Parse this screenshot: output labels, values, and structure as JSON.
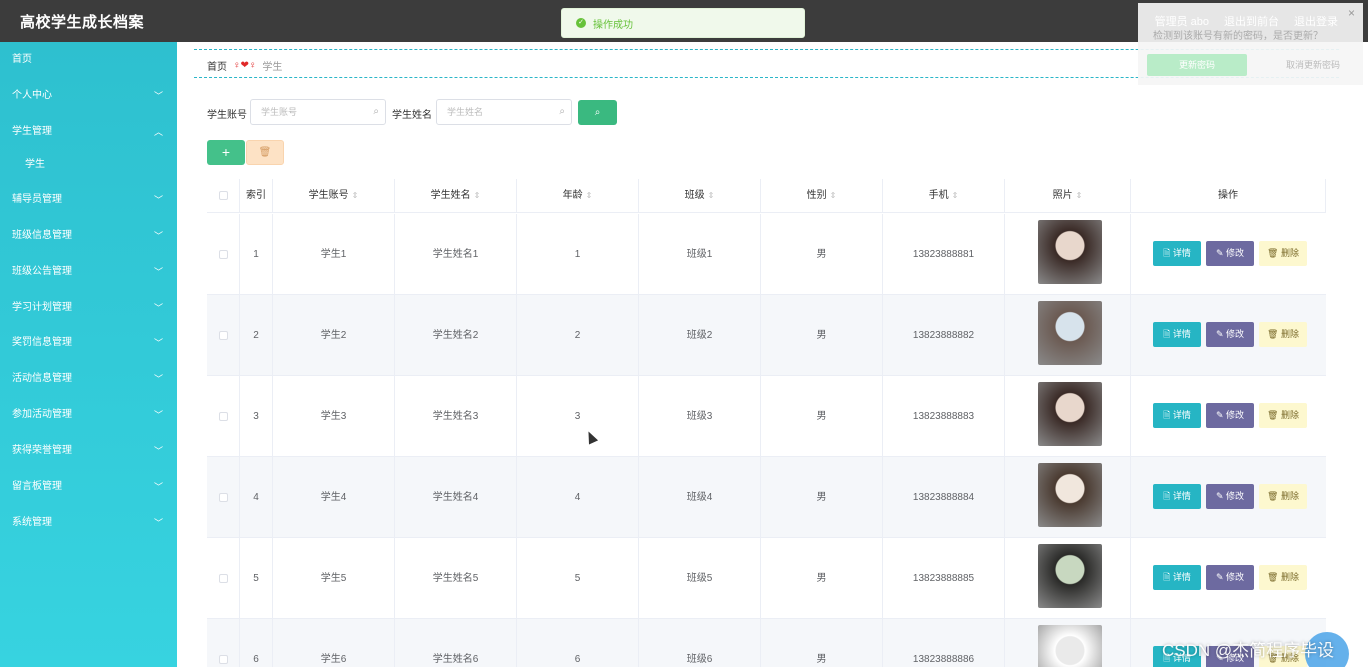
{
  "app": {
    "title": "高校学生成长档案"
  },
  "toast": {
    "message": "操作成功"
  },
  "header": {
    "links": [
      "管理员 abo",
      "退出到前台",
      "退出登录"
    ]
  },
  "notice": {
    "message": "检测到该账号有新的密码，是否更新？",
    "update_label": "更新密码",
    "cancel_label": "取消更新密码"
  },
  "sidebar": {
    "items": [
      {
        "label": "首页",
        "chevron": ""
      },
      {
        "label": "个人中心",
        "chevron": "v"
      },
      {
        "label": "学生管理",
        "chevron": "^"
      },
      {
        "label": "学生",
        "chevron": ""
      },
      {
        "label": "辅导员管理",
        "chevron": "v"
      },
      {
        "label": "班级信息管理",
        "chevron": "v"
      },
      {
        "label": "班级公告管理",
        "chevron": "v"
      },
      {
        "label": "学习计划管理",
        "chevron": "v"
      },
      {
        "label": "奖罚信息管理",
        "chevron": "v"
      },
      {
        "label": "活动信息管理",
        "chevron": "v"
      },
      {
        "label": "参加活动管理",
        "chevron": "v"
      },
      {
        "label": "获得荣誉管理",
        "chevron": "v"
      },
      {
        "label": "留言板管理",
        "chevron": "v"
      },
      {
        "label": "系统管理",
        "chevron": "v"
      }
    ]
  },
  "breadcrumb": {
    "home": "首页",
    "separator": "♀❤♀",
    "current": "学生"
  },
  "search": {
    "account_label": "学生账号",
    "account_placeholder": "学生账号",
    "name_label": "学生姓名",
    "name_placeholder": "学生姓名",
    "search_icon": "search-icon"
  },
  "toolbar": {
    "add_label": "+",
    "delete_icon": "trash-icon"
  },
  "table": {
    "headers": [
      "索引",
      "学生账号",
      "学生姓名",
      "年龄",
      "班级",
      "性别",
      "手机",
      "照片",
      "操作"
    ],
    "actions": {
      "detail": "详情",
      "edit": "修改",
      "delete": "删除"
    },
    "rows": [
      {
        "index": "1",
        "account": "学生1",
        "name": "学生姓名1",
        "age": "1",
        "class": "班级1",
        "gender": "男",
        "phone": "13823888881"
      },
      {
        "index": "2",
        "account": "学生2",
        "name": "学生姓名2",
        "age": "2",
        "class": "班级2",
        "gender": "男",
        "phone": "13823888882"
      },
      {
        "index": "3",
        "account": "学生3",
        "name": "学生姓名3",
        "age": "3",
        "class": "班级3",
        "gender": "男",
        "phone": "13823888883"
      },
      {
        "index": "4",
        "account": "学生4",
        "name": "学生姓名4",
        "age": "4",
        "class": "班级4",
        "gender": "男",
        "phone": "13823888884"
      },
      {
        "index": "5",
        "account": "学生5",
        "name": "学生姓名5",
        "age": "5",
        "class": "班级5",
        "gender": "男",
        "phone": "13823888885"
      },
      {
        "index": "6",
        "account": "学生6",
        "name": "学生姓名6",
        "age": "6",
        "class": "班级6",
        "gender": "男",
        "phone": "13823888886"
      }
    ]
  },
  "watermark": "CSDN @杰简程序毕设",
  "colors": {
    "sidebar": "#32cad8",
    "topbar": "#3c3c3c",
    "detail": "#26b5c4",
    "edit": "#6d6aa0",
    "delete": "#fdf8cf",
    "search_button": "#3ab980"
  }
}
